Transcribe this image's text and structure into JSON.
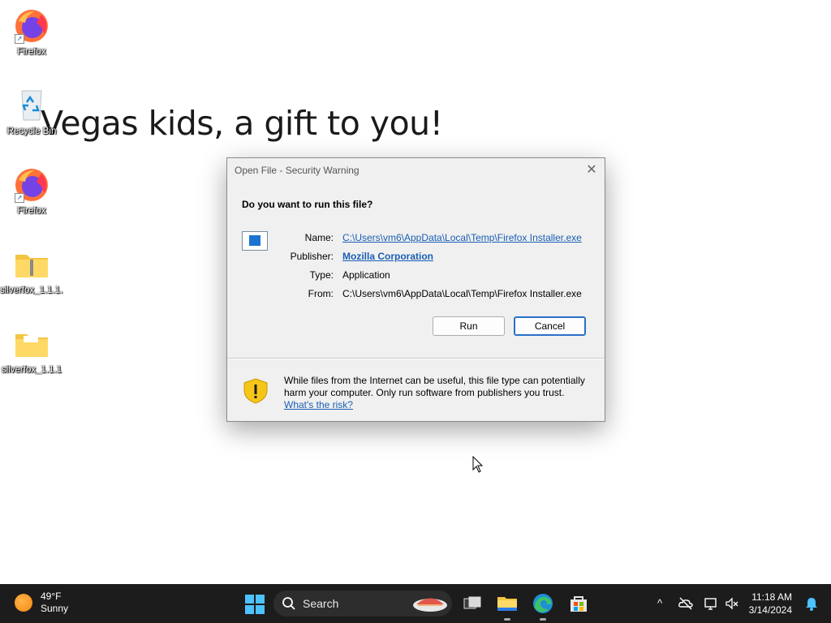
{
  "desktop": {
    "wallpaper_text": "Vegas kids, a gift to you!",
    "icons": [
      {
        "label": "Firefox"
      },
      {
        "label": "Recycle Bin"
      },
      {
        "label": "Firefox"
      },
      {
        "label": "silverfox_1.1.1..."
      },
      {
        "label": "silverfox_1.1.1"
      }
    ]
  },
  "dialog": {
    "title": "Open File - Security Warning",
    "close_glyph": "✕",
    "question": "Do you want to run this file?",
    "fields": {
      "name_label": "Name:",
      "name_value": "C:\\Users\\vm6\\AppData\\Local\\Temp\\Firefox Installer.exe",
      "publisher_label": "Publisher:",
      "publisher_value": "Mozilla Corporation",
      "type_label": "Type:",
      "type_value": "Application",
      "from_label": "From:",
      "from_value": "C:\\Users\\vm6\\AppData\\Local\\Temp\\Firefox Installer.exe"
    },
    "run_label": "Run",
    "cancel_label": "Cancel",
    "warning_text": "While files from the Internet can be useful, this file type can potentially harm your computer. Only run software from publishers you trust.",
    "risk_link": "What's the risk?"
  },
  "taskbar": {
    "weather_temp": "49°F",
    "weather_desc": "Sunny",
    "search_placeholder": "Search",
    "tray_chevron": "^",
    "time": "11:18 AM",
    "date": "3/14/2024"
  },
  "colors": {
    "taskbar_bg": "#1c1c1c",
    "dialog_bg": "#f0f0f0",
    "link": "#1a5fb4",
    "accent": "#4cc2ff"
  }
}
